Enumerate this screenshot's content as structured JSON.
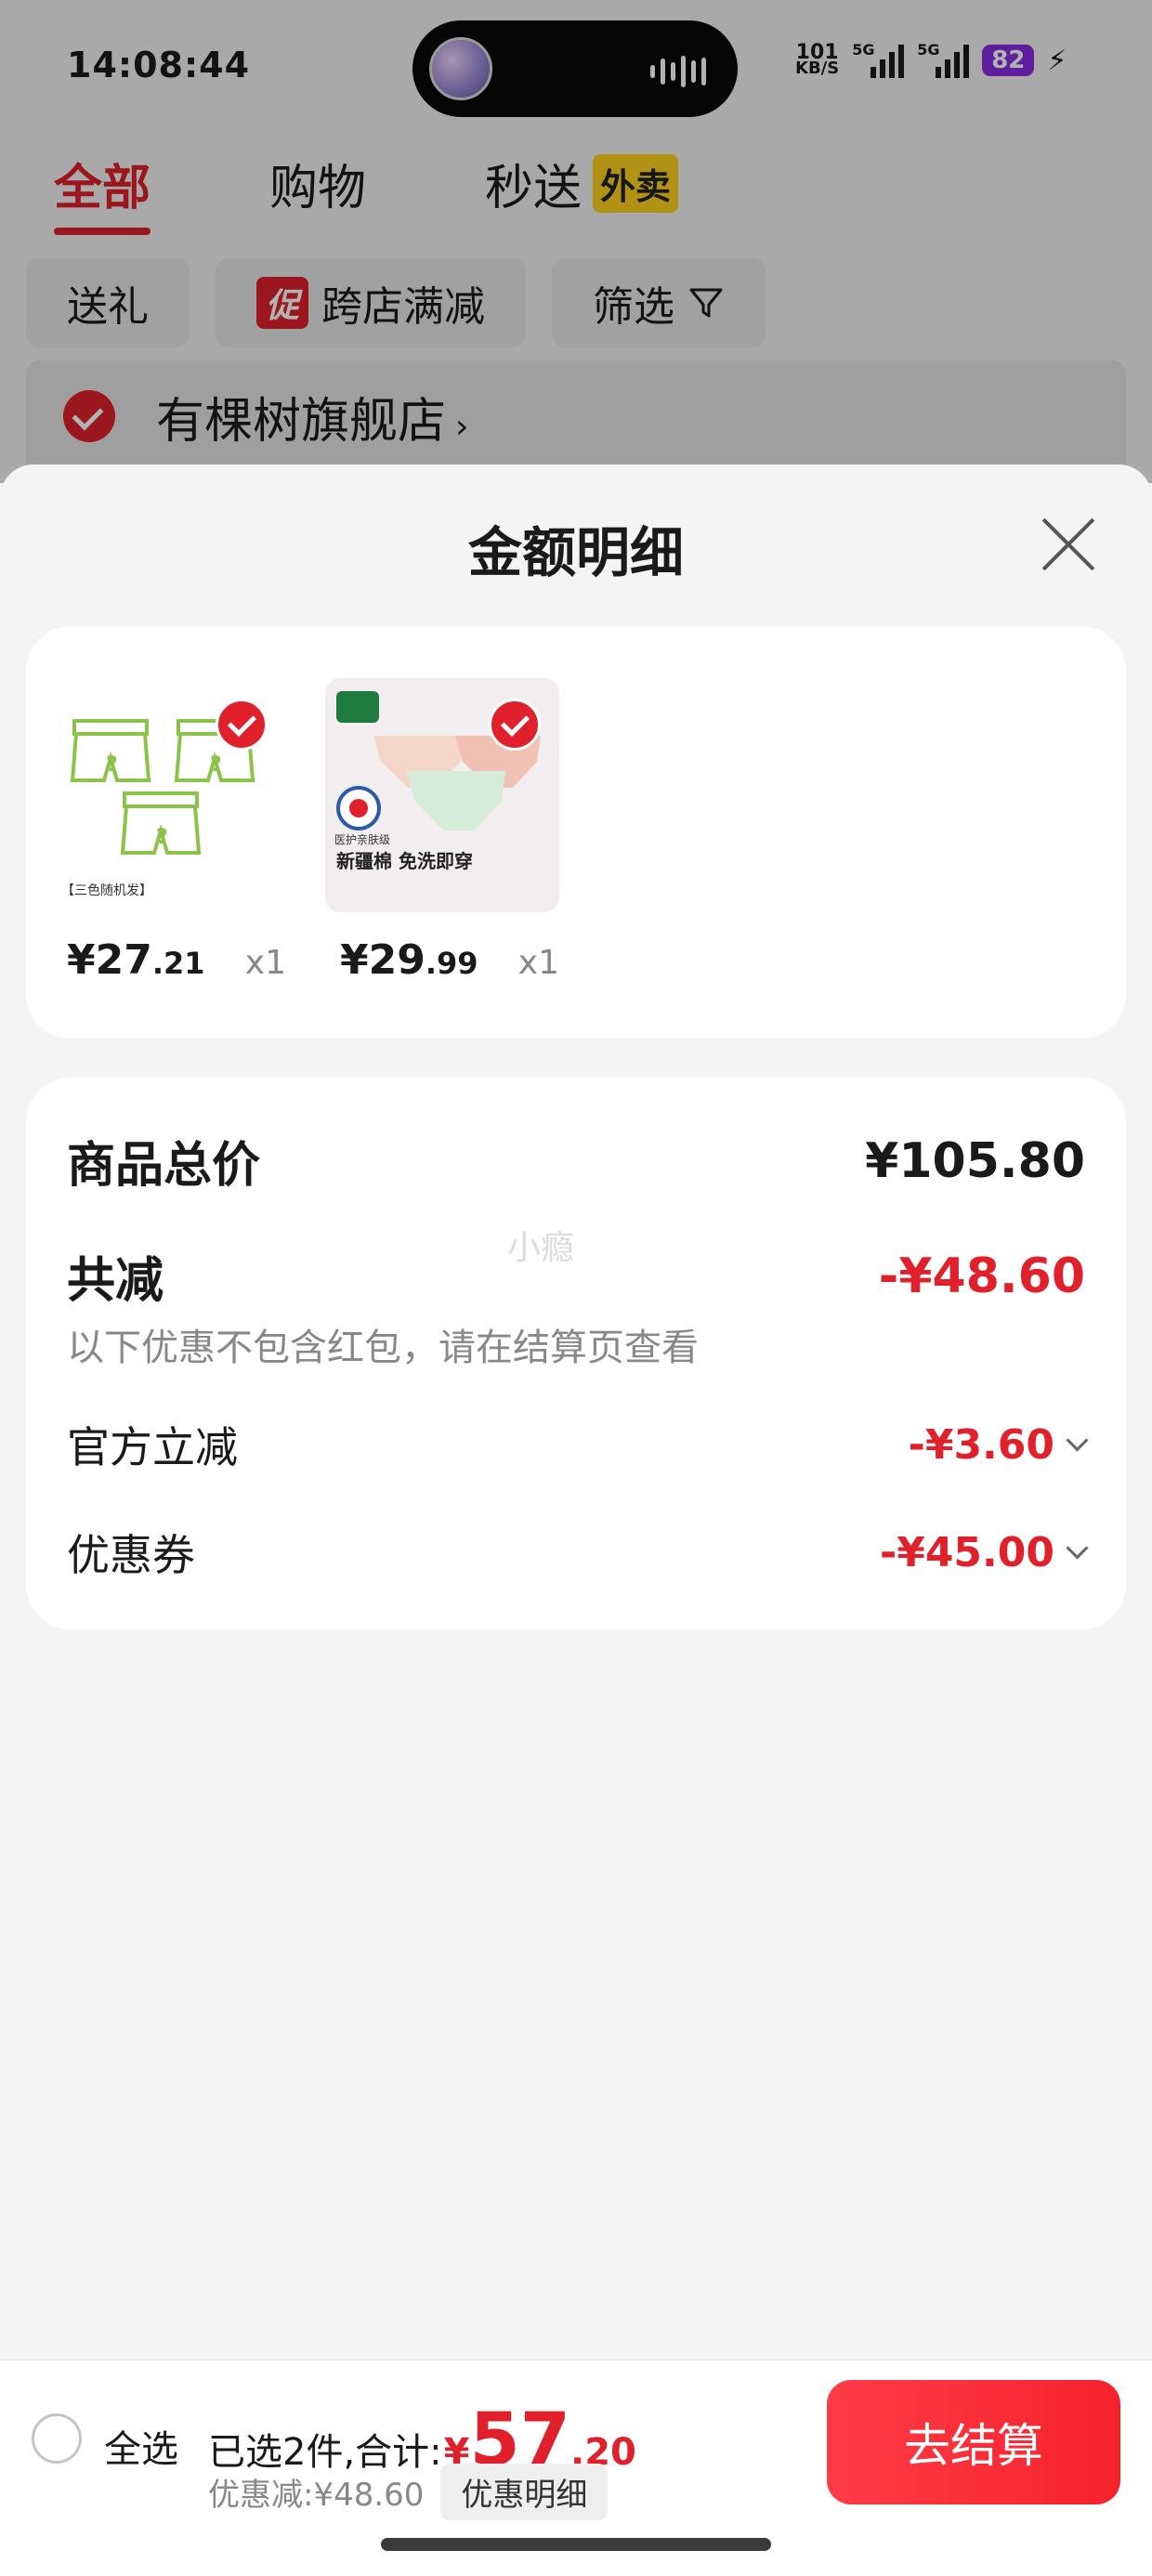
{
  "status_bar": {
    "time": "14:08:44",
    "net_speed_value": "101",
    "net_speed_unit": "KB/S",
    "sim1_label": "5G",
    "sim2_label": "5G",
    "battery": "82"
  },
  "top_tabs": [
    {
      "label": "全部",
      "active": true
    },
    {
      "label": "购物",
      "active": false
    },
    {
      "label": "秒送",
      "active": false,
      "badge": "外卖"
    }
  ],
  "filter_chips": {
    "gift": "送礼",
    "promo_tag": "促",
    "promo_label": "跨店满减",
    "filter_label": "筛选"
  },
  "store": {
    "name": "有棵树旗舰店"
  },
  "sheet": {
    "title": "金额明细"
  },
  "products": [
    {
      "price_int": "¥27",
      "price_dec": ".21",
      "qty": "x1",
      "image_caption": "【三色随机发】"
    },
    {
      "price_int": "¥29",
      "price_dec": ".99",
      "qty": "x1",
      "image_caption": "新疆棉 免洗即穿",
      "image_badge": "医护亲肤级"
    }
  ],
  "summary": {
    "total_label": "商品总价",
    "total_value": "¥105.80",
    "reduce_label": "共减",
    "reduce_value": "-¥48.60",
    "note": "以下优惠不包含红包，请在结算页查看",
    "official_label": "官方立减",
    "official_value": "-¥3.60",
    "coupon_label": "优惠券",
    "coupon_value": "-¥45.00",
    "watermark": "小瘾"
  },
  "bottom_bar": {
    "select_all": "全选",
    "selected_text": "已选2件,合计:",
    "yen": "¥",
    "total_int": "57",
    "total_dec": ".20",
    "discount_text": "优惠减:¥48.60",
    "discount_detail": "优惠明细",
    "checkout": "去结算"
  },
  "colors": {
    "accent_red": "#e0202a",
    "badge_yellow": "#ffd21f",
    "battery_purple": "#8a2be2"
  }
}
